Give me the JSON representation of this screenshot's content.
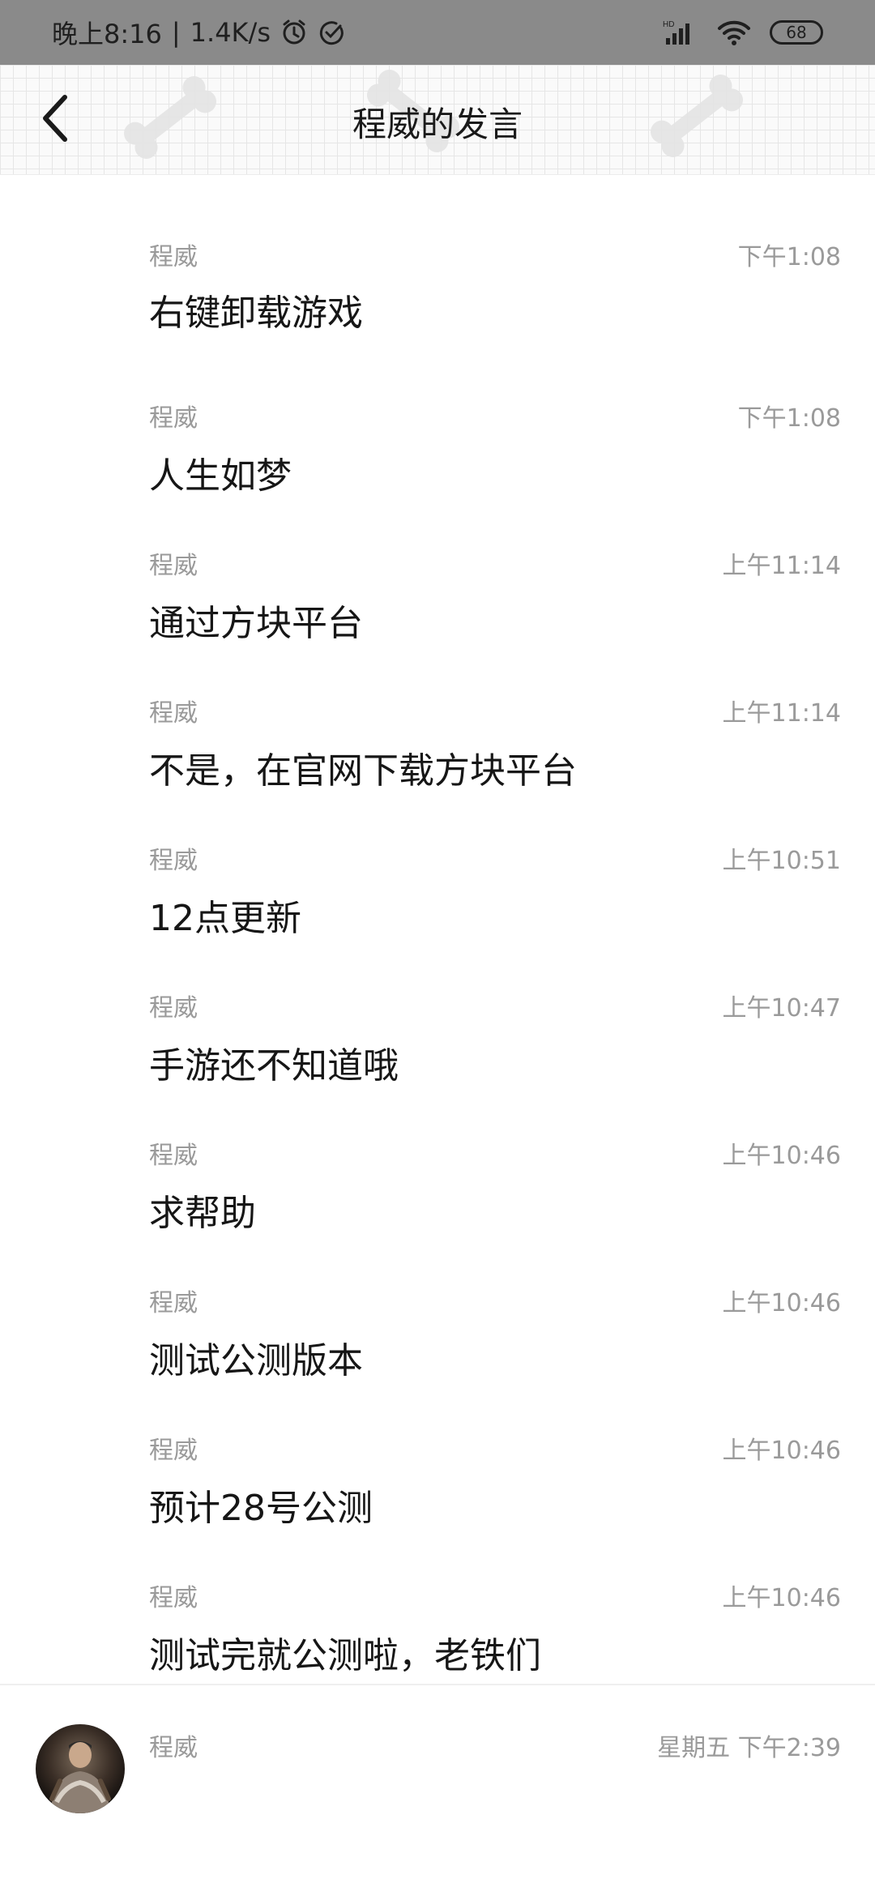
{
  "status_bar": {
    "time": "晚上8:16",
    "speed": "1.4K/s",
    "battery": "68",
    "network_label": "HD"
  },
  "header": {
    "title": "程威的发言",
    "back_icon": "chevron-left-icon",
    "decoration_icon": "bone-icon"
  },
  "messages": [
    {
      "sender": "程威",
      "time": "下午1:08",
      "text": "右键卸载游戏"
    },
    {
      "sender": "程威",
      "time": "下午1:08",
      "text": "人生如梦"
    },
    {
      "sender": "程威",
      "time": "上午11:14",
      "text": "通过方块平台"
    },
    {
      "sender": "程威",
      "time": "上午11:14",
      "text": "不是，在官网下载方块平台"
    },
    {
      "sender": "程威",
      "time": "上午10:51",
      "text": "12点更新"
    },
    {
      "sender": "程威",
      "time": "上午10:47",
      "text": "手游还不知道哦"
    },
    {
      "sender": "程威",
      "time": "上午10:46",
      "text": "求帮助"
    },
    {
      "sender": "程威",
      "time": "上午10:46",
      "text": "测试公测版本"
    },
    {
      "sender": "程威",
      "time": "上午10:46",
      "text": "预计28号公测"
    },
    {
      "sender": "程威",
      "time": "上午10:46",
      "text": "测试完就公测啦，老铁们"
    }
  ],
  "last_item": {
    "sender": "程威",
    "time": "星期五 下午2:39"
  }
}
